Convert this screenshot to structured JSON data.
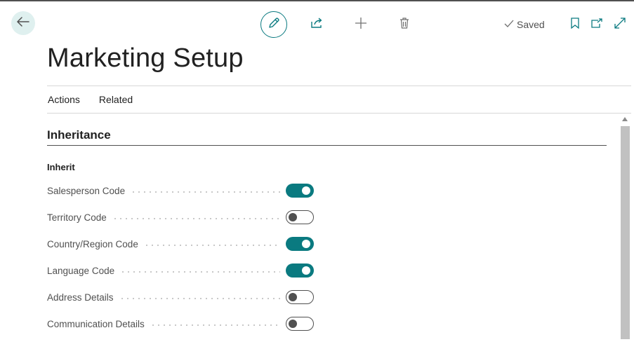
{
  "window": {
    "title": "Marketing Setup"
  },
  "toolbar": {
    "back_icon": "arrow-left-icon",
    "edit_icon": "pencil-icon",
    "share_icon": "share-icon",
    "add_icon": "plus-icon",
    "delete_icon": "trash-icon",
    "status": "Saved",
    "status_icon": "checkmark-icon",
    "bookmark_icon": "bookmark-icon",
    "popout_icon": "open-new-window-icon",
    "expand_icon": "expand-icon"
  },
  "menu": {
    "actions": "Actions",
    "related": "Related"
  },
  "section": {
    "title": "Inheritance",
    "group": "Inherit",
    "fields": [
      {
        "label": "Salesperson Code",
        "value": true
      },
      {
        "label": "Territory Code",
        "value": false
      },
      {
        "label": "Country/Region Code",
        "value": true
      },
      {
        "label": "Language Code",
        "value": true
      },
      {
        "label": "Address Details",
        "value": false
      },
      {
        "label": "Communication Details",
        "value": false
      }
    ]
  },
  "colors": {
    "accent": "#0a7a80",
    "back_bg": "#dff0ef",
    "text": "#212121",
    "muted": "#505050"
  }
}
